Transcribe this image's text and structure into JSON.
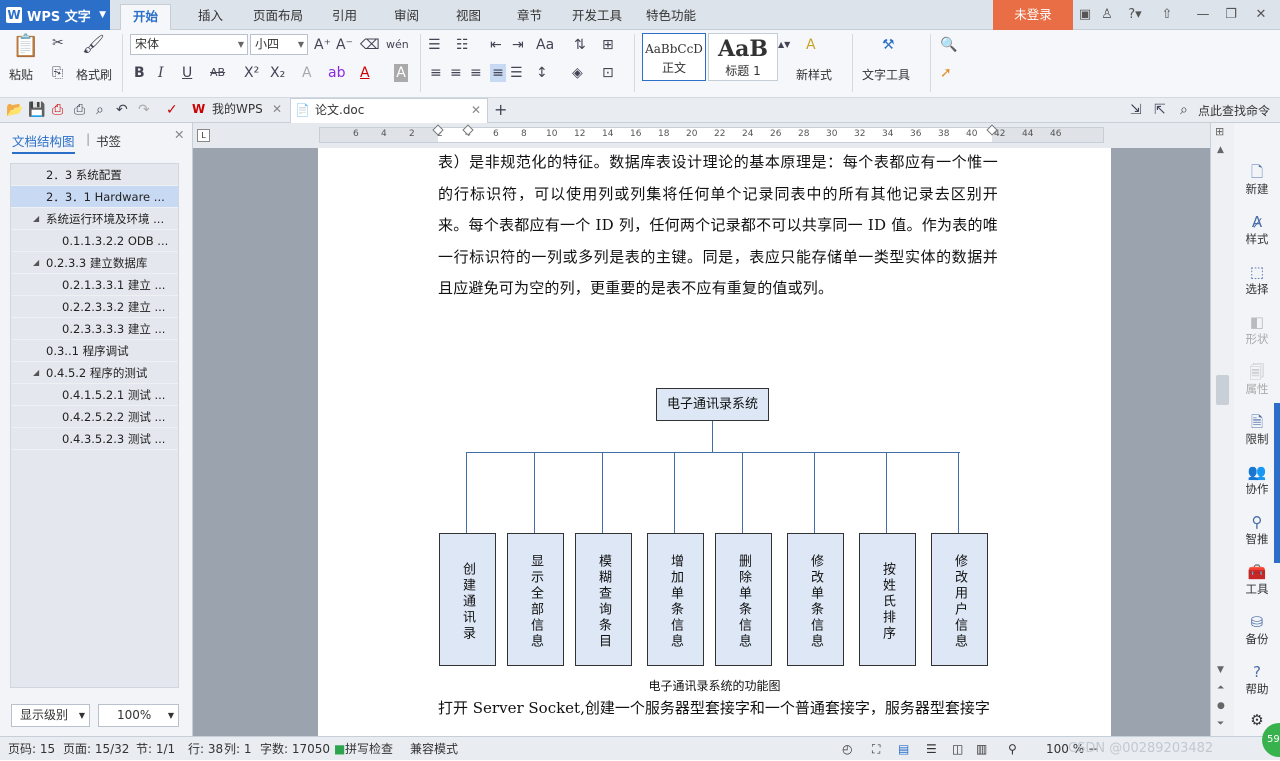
{
  "app": {
    "name": "WPS 文字",
    "logo": "W"
  },
  "menu_tabs": [
    "开始",
    "插入",
    "页面布局",
    "引用",
    "审阅",
    "视图",
    "章节",
    "开发工具",
    "特色功能"
  ],
  "active_tab": "开始",
  "login_label": "未登录",
  "ribbon": {
    "paste_label": "粘贴",
    "format_painter_label": "格式刷",
    "font_name": "宋体",
    "font_size": "小四",
    "styles": [
      {
        "preview": "AaBbCcD",
        "label": "正文"
      },
      {
        "preview": "AaB",
        "label": "标题 1"
      }
    ],
    "new_style_label": "新样式",
    "text_tools_label": "文字工具"
  },
  "doc_tabs": [
    {
      "label": "我的WPS"
    },
    {
      "label": "论文.doc"
    }
  ],
  "find_label": "点此查找命令",
  "left_panel": {
    "tab_outline": "文档结构图",
    "tab_bookmark": "书签",
    "outline": [
      {
        "label": "2．3  系统配置"
      },
      {
        "label": "2．3．1 Hardware ..."
      },
      {
        "label": "系统运行环境及环境 ..."
      },
      {
        "label": "0.1.1.3.2.2 ODB ..."
      },
      {
        "label": "0.2.3.3  建立数据库"
      },
      {
        "label": "0.2.1.3.3.1  建立 ..."
      },
      {
        "label": "0.2.2.3.3.2  建立 ..."
      },
      {
        "label": "0.2.3.3.3.3  建立 ..."
      },
      {
        "label": "0.3..1  程序调试"
      },
      {
        "label": "0.4.5.2  程序的测试"
      },
      {
        "label": "0.4.1.5.2.1  测试 ..."
      },
      {
        "label": "0.4.2.5.2.2  测试 ..."
      },
      {
        "label": "0.4.3.5.2.3  测试 ..."
      }
    ],
    "level_select": "显示级别",
    "zoom_select": "100%"
  },
  "ruler_ticks": [
    "6",
    "4",
    "2",
    "2",
    "4",
    "6",
    "8",
    "10",
    "12",
    "14",
    "16",
    "18",
    "20",
    "22",
    "24",
    "26",
    "28",
    "30",
    "32",
    "34",
    "36",
    "38",
    "40",
    "42",
    "44",
    "46"
  ],
  "document": {
    "para1": "表）是非规范化的特征。数据库表设计理论的基本原理是：每个表都应有一个惟一的行标识符，可以使用列或列集将任何单个记录同表中的所有其他记录去区别开来。每个表都应有一个 ID 列，任何两个记录都不可以共享同一 ID 值。作为表的唯一行标识符的一列或多列是表的主键。同是，表应只能存储单一类型实体的数据并且应避免可为空的列，更重要的是表不应有重复的值或列。",
    "diagram_root": "电子通讯录系统",
    "diagram_children": [
      "创建通讯录",
      "显示全部信息",
      "模糊查询条目",
      "增加单条信息",
      "删除单条信息",
      "修改单条信息",
      "按姓氏排序",
      "修改用户信息"
    ],
    "caption": "电子通讯录系统的功能图",
    "para2": "打开 Server Socket,创建一个服务器型套接字和一个普通套接字，服务器型套接字"
  },
  "right_bar": [
    {
      "label": "新建",
      "icon": "new-doc-icon"
    },
    {
      "label": "样式",
      "icon": "style-icon"
    },
    {
      "label": "选择",
      "icon": "select-icon"
    },
    {
      "label": "形状",
      "icon": "shape-icon"
    },
    {
      "label": "属性",
      "icon": "property-icon"
    },
    {
      "label": "限制",
      "icon": "restrict-icon"
    },
    {
      "label": "协作",
      "icon": "collab-icon"
    },
    {
      "label": "智推",
      "icon": "recommend-icon"
    },
    {
      "label": "工具",
      "icon": "toolbox-icon"
    },
    {
      "label": "备份",
      "icon": "backup-icon"
    },
    {
      "label": "帮助",
      "icon": "help-icon"
    }
  ],
  "status": {
    "page_num": "页码: 15",
    "page_of": "页面: 15/32",
    "section": "节: 1/1",
    "row": "行: 38",
    "col": "列: 1",
    "word_count": "字数: 17050",
    "spell": "拼写检查",
    "compat": "兼容模式",
    "zoom": "100 %",
    "watermark": "CSDN @00289203482"
  },
  "colors": {
    "accent": "#2b6fc9",
    "login": "#e96d45",
    "diagram_box": "#dde7f5",
    "diagram_line": "#3f6ea8"
  }
}
